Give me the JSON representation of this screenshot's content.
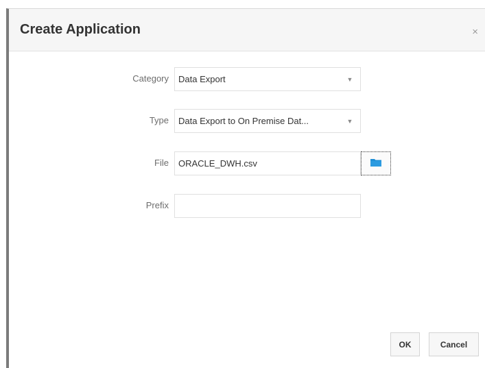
{
  "dialog": {
    "title": "Create Application",
    "close_symbol": "×"
  },
  "form": {
    "category": {
      "label": "Category",
      "value": "Data Export",
      "caret": "▼"
    },
    "type": {
      "label": "Type",
      "value": "Data Export to On Premise Dat...",
      "caret": "▼"
    },
    "file": {
      "label": "File",
      "value": "ORACLE_DWH.csv",
      "browse_icon": "folder-icon"
    },
    "prefix": {
      "label": "Prefix",
      "value": ""
    }
  },
  "buttons": {
    "ok_label": "OK",
    "cancel_label": "Cancel"
  },
  "colors": {
    "folder_icon": "#1f8fd6",
    "title_bar": "#f6f6f6",
    "left_border": "#7b7b7b"
  }
}
